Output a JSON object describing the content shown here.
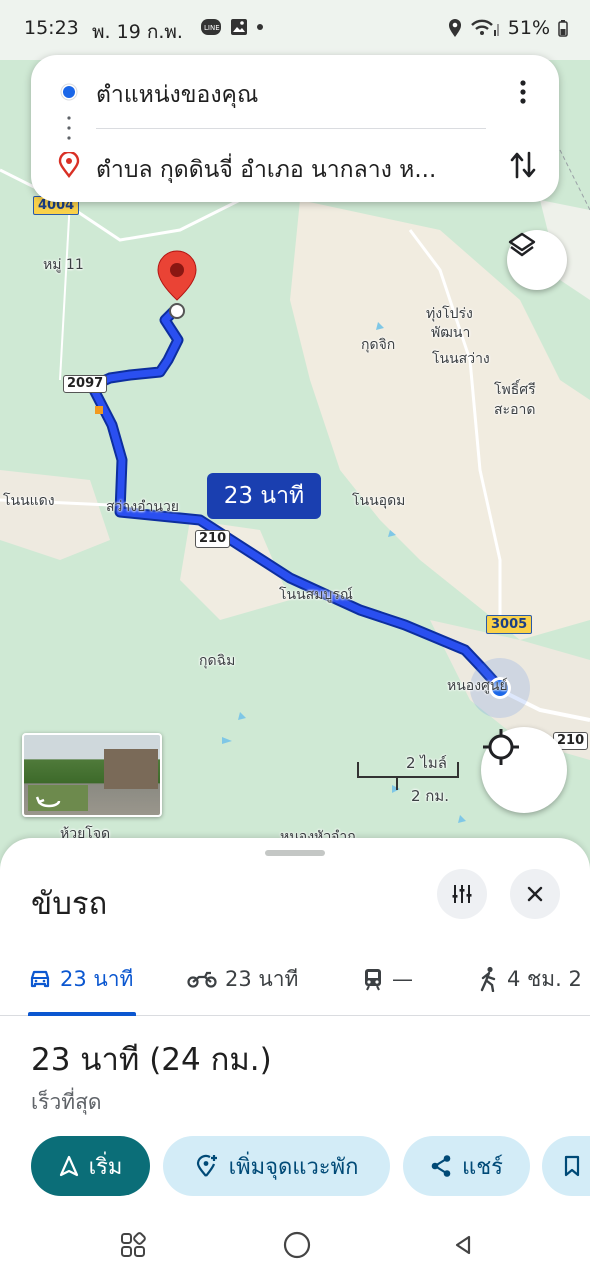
{
  "status_bar": {
    "time": "15:23",
    "date": "พ. 19 ก.พ.",
    "battery": "51%"
  },
  "route_card": {
    "origin": "ตำแหน่งของคุณ",
    "destination": "ตำบล กุดดินจี่ อำเภอ นากลาง ห..."
  },
  "map": {
    "eta_bubble": "23 นาที",
    "labels": {
      "moo11": "หมู่ 11",
      "thung_prong": "ทุ่งโปร่ง",
      "phatthana": "พัฒนา",
      "kut_chik": "กุดจิก",
      "non_sawang": "โนนสว่าง",
      "pho_si": "โพธิ์ศรี",
      "sa_at": "สะอาด",
      "non_daeng": "โนนแดง",
      "sawang_amnuai": "สว่างอำนวย",
      "non_udom": "โนนอุดม",
      "non_sombun": "โนนสมบูรณ์",
      "kut_chim": "กุดฉิม",
      "nong_sun": "หนองศูนย์",
      "huai_chot": "ห้วยโจด",
      "nong_hua_cham": "หนองหัวจำก"
    },
    "road_shields": {
      "r4004": "4004",
      "r2097": "2097",
      "r210a": "210",
      "r3005": "3005",
      "r210b": "210"
    },
    "scale": {
      "miles": "2 ไมล์",
      "km": "2 กม."
    }
  },
  "sheet": {
    "title": "ขับรถ",
    "modes": [
      {
        "label": "23 นาที"
      },
      {
        "label": "23 นาที"
      },
      {
        "label": "—"
      },
      {
        "label": "4 ชม. 2"
      }
    ],
    "eta_main": "23 นาที (24 กม.)",
    "eta_sub": "เร็วที่สุด",
    "actions": {
      "start": "เริ่ม",
      "add_stop": "เพิ่มจุดแวะพัก",
      "share": "แชร์"
    }
  },
  "colors": {
    "route": "#1a3fe0",
    "accent": "#0b57d0",
    "start_button": "#0b6e78",
    "pin": "#d93025"
  }
}
